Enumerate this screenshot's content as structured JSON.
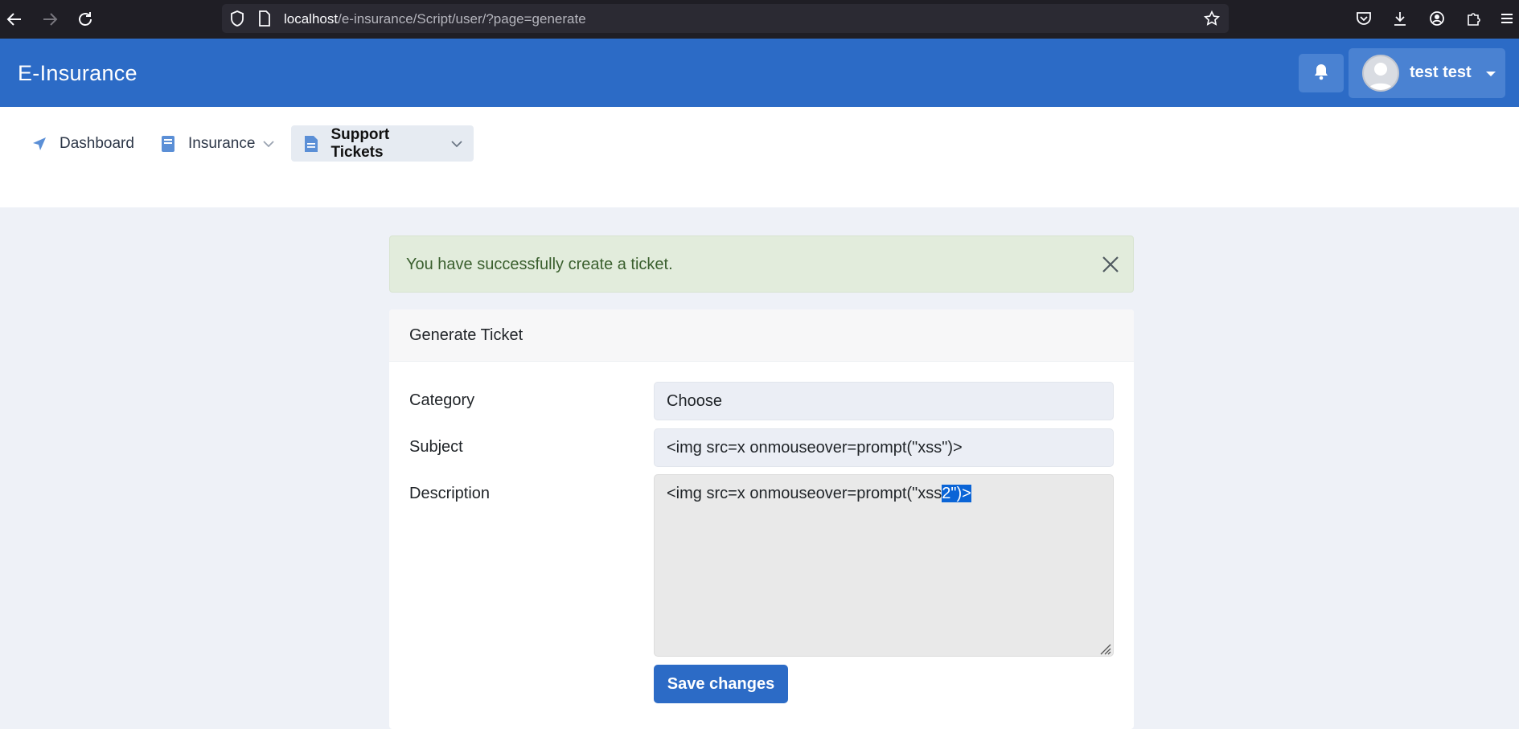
{
  "browser": {
    "url_host": "localhost",
    "url_path": "/e-insurance/Script/user/?page=generate"
  },
  "header": {
    "brand": "E-Insurance",
    "user_name": "test test"
  },
  "nav": {
    "items": [
      {
        "label": "Dashboard",
        "icon": "paper-plane-icon"
      },
      {
        "label": "Insurance",
        "icon": "book-icon"
      },
      {
        "label": "Support Tickets",
        "icon": "file-icon"
      }
    ]
  },
  "alert": {
    "message": "You have successfully create a ticket."
  },
  "form": {
    "title": "Generate Ticket",
    "category_label": "Category",
    "category_value": "Choose",
    "subject_label": "Subject",
    "subject_value": "<img src=x onmouseover=prompt(\"xss\")>",
    "description_label": "Description",
    "description_value_plain": "<img src=x onmouseover=prompt(\"xss",
    "description_value_selected": "2\")>",
    "save_label": "Save changes"
  },
  "colors": {
    "header_bg": "#2c6bc6",
    "alert_bg": "#e2ecdc",
    "page_bg": "#eef1f7",
    "selection": "#0a64d6"
  }
}
